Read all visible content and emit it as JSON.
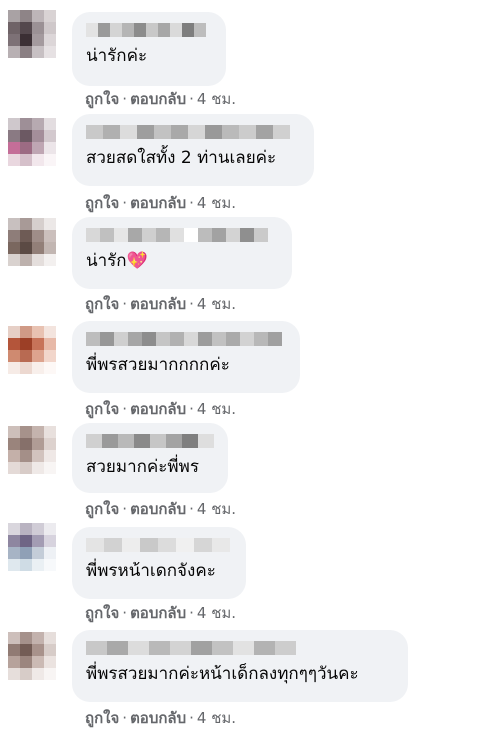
{
  "comments": [
    {
      "text": "น่ารักค่ะ",
      "like": "ถูกใจ",
      "reply": "ตอบกลับ",
      "time": "4 ชม.",
      "avatar": [
        "#a9a2a4",
        "#8e8487",
        "#bdb5b8",
        "#d9d3d4",
        "#6f6367",
        "#54484d",
        "#9b9195",
        "#cfc8ca",
        "#7d7176",
        "#3b2f34",
        "#a49a9e",
        "#dcd6d8",
        "#b8b0b3",
        "#8a7f83",
        "#c7c0c3",
        "#e6e1e3"
      ],
      "name": [
        "#e3e3e3",
        "#9a9a9a",
        "#d4d4d4",
        "#b5b5b5",
        "#8c8c8c",
        "#c8c8c8",
        "#a7a7a7",
        "#dadada",
        "#7e7e7e",
        "#bdbdbd"
      ]
    },
    {
      "text": "สวยสดใสทั้ง 2 ท่านเลยค่ะ",
      "like": "ถูกใจ",
      "reply": "ตอบกลับ",
      "time": "4 ชม.",
      "avatar": [
        "#cfc8cc",
        "#9e8f97",
        "#b7aab1",
        "#e3dde0",
        "#8a7a83",
        "#6c5963",
        "#a48e9a",
        "#d3c9ce",
        "#c46e98",
        "#9c6b83",
        "#bfa6b3",
        "#ece5e9",
        "#e9d7df",
        "#d5c0ca",
        "#f2e7ec",
        "#faf5f7"
      ],
      "name": [
        "#c9c9c9",
        "#b0b0b0",
        "#dcdcdc",
        "#9e9e9e",
        "#c2c2c2",
        "#a9a9a9",
        "#d6d6d6",
        "#999999",
        "#bababa",
        "#cccccc",
        "#a3a3a3",
        "#d0d0d0"
      ]
    },
    {
      "text": "น่ารัก",
      "emoji": "💖",
      "like": "ถูกใจ",
      "reply": "ตอบกลับ",
      "time": "4 ชม.",
      "avatar": [
        "#c8c0bf",
        "#a89a97",
        "#d6cfcd",
        "#ece8e7",
        "#8e7d79",
        "#6e5b55",
        "#9f8d88",
        "#cbbfbc",
        "#7a675f",
        "#5b4a44",
        "#927f78",
        "#c2b6b2",
        "#d9d2cf",
        "#bdb1ad",
        "#e4dedc",
        "#f3f0ef"
      ],
      "name": [
        "#d8d8d8",
        "#c0c0c0",
        "#e6e6e6",
        "#a8a8a8",
        "#cfcfcf",
        "#b6b6b6",
        "#e0e0e0",
        "#ffffff",
        "#bcbcbc",
        "#a2a2a2",
        "#d3d3d3",
        "#8f8f8f",
        "#cacaca"
      ]
    },
    {
      "text": "พี่พรสวยมากกกกค่ะ",
      "like": "ถูกใจ",
      "reply": "ตอบกลับ",
      "time": "4 ชม.",
      "avatar": [
        "#e6cfc6",
        "#d09a86",
        "#e8c2b2",
        "#f3e4de",
        "#b4553a",
        "#9c3f26",
        "#c77359",
        "#e7b9a8",
        "#cf8a70",
        "#b86a52",
        "#dda38e",
        "#f2d6cb",
        "#f6ebe6",
        "#ecd8d0",
        "#f8efeb",
        "#fdf8f6"
      ],
      "name": [
        "#bdbdbd",
        "#979797",
        "#cfcfcf",
        "#a6a6a6",
        "#8d8d8d",
        "#c5c5c5",
        "#b1b1b1",
        "#d8d8d8",
        "#9c9c9c",
        "#c1c1c1",
        "#aaaaaa",
        "#d2d2d2",
        "#b8b8b8",
        "#a0a0a0"
      ]
    },
    {
      "text": "สวยมากค่ะพี่พร",
      "like": "ถูกใจ",
      "reply": "ตอบกลับ",
      "time": "4 ชม.",
      "avatar": [
        "#cdbfba",
        "#a6928b",
        "#c4b3ad",
        "#e8e0dd",
        "#9a847c",
        "#86706a",
        "#b09c95",
        "#ddd2ce",
        "#c4b0a9",
        "#a48f88",
        "#d2c3be",
        "#efe8e6",
        "#e4dad7",
        "#d8ccc8",
        "#efe9e7",
        "#f8f5f4"
      ],
      "name": [
        "#d0d0d0",
        "#9a9a9a",
        "#b9b9b9",
        "#8a8a8a",
        "#c6c6c6",
        "#a3a3a3",
        "#7f7f7f",
        "#dedede"
      ]
    },
    {
      "text": "พี่พรหน้าเดกจังคะ",
      "like": "ถูกใจ",
      "reply": "ตอบกลับ",
      "time": "4 ชม.",
      "avatar": [
        "#d9d6dd",
        "#b9b3c1",
        "#d0ccd6",
        "#ecebef",
        "#8e86a0",
        "#6f6585",
        "#a39cb3",
        "#d7d3de",
        "#a7b4c5",
        "#8fa0b6",
        "#c4cdd8",
        "#eef1f5",
        "#dfe8ee",
        "#cfdce5",
        "#eaf0f4",
        "#f7f9fb"
      ],
      "name": [
        "#e4e4e4",
        "#d2d2d2",
        "#ededed",
        "#c9c9c9",
        "#dcdcdc",
        "#f0f0f0",
        "#d6d6d6",
        "#e8e8e8"
      ]
    },
    {
      "text": "พี่พรสวยมากค่ะหน้าเด็กลงทุกๆๆวันคะ",
      "like": "ถูกใจ",
      "reply": "ตอบกลับ",
      "time": "4 ชม.",
      "avatar": [
        "#cdbfbb",
        "#a5918b",
        "#c3b2ad",
        "#e6dedb",
        "#917b74",
        "#735c55",
        "#a8928b",
        "#d7ccc8",
        "#b6a29b",
        "#9b857e",
        "#cbbab4",
        "#ebe3e0",
        "#e6dedb",
        "#d7ccc8",
        "#efe9e7",
        "#f8f5f4"
      ],
      "name": [
        "#c8c8c8",
        "#a9a9a9",
        "#dcdcdc",
        "#b9b9b9",
        "#d3d3d3",
        "#a1a1a1",
        "#c2c2c2",
        "#e2e2e2",
        "#b3b3b3",
        "#cdcdcd"
      ]
    }
  ]
}
